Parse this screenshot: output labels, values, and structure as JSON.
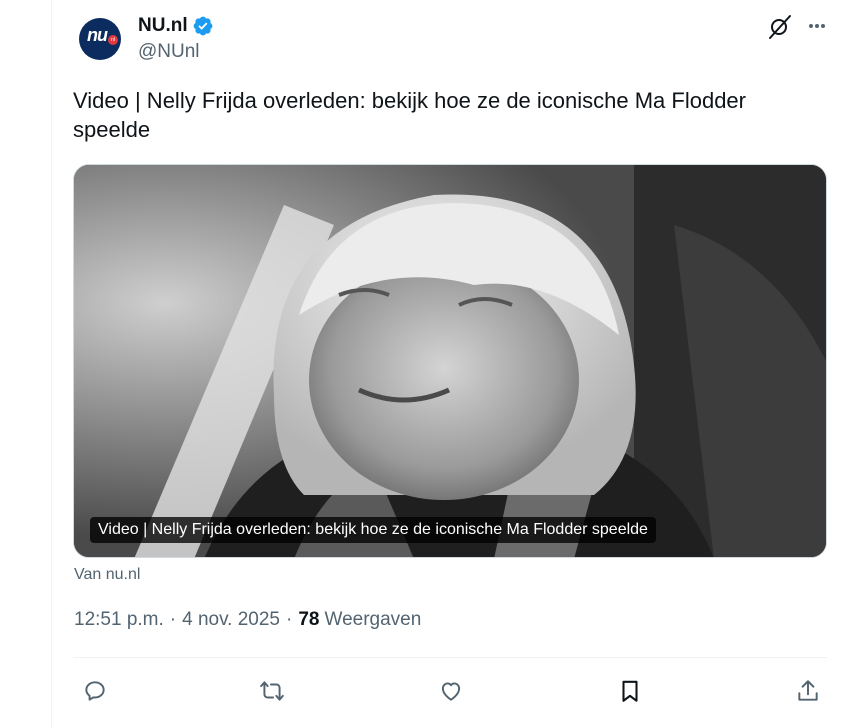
{
  "tweet": {
    "author": {
      "display_name": "NU.nl",
      "handle": "@NUnl",
      "verified": true,
      "avatar_logo_text": "nu",
      "avatar_logo_badge": "nl"
    },
    "text": "Video | Nelly Frijda overleden: bekijk hoe ze de iconische Ma Flodder speelde",
    "card": {
      "caption": "Video | Nelly Frijda overleden: bekijk hoe ze de iconische Ma Flodder speelde",
      "image_description": "black-and-white portrait of an older woman with light hair",
      "source": "Van nu.nl"
    },
    "meta": {
      "time": "12:51 p.m.",
      "separator": "·",
      "date": "4 nov. 2025",
      "views_count": "78",
      "views_label": "Weergaven"
    }
  },
  "header_icons": [
    "grok-icon",
    "more-icon"
  ],
  "actions": [
    "reply-icon",
    "repost-icon",
    "like-icon",
    "bookmark-icon",
    "share-icon"
  ],
  "colors": {
    "text_primary": "#0f1419",
    "text_secondary": "#536471",
    "verified_blue": "#1d9bf0",
    "divider": "#eff3f4",
    "avatar_bg": "#0c2b5e"
  }
}
